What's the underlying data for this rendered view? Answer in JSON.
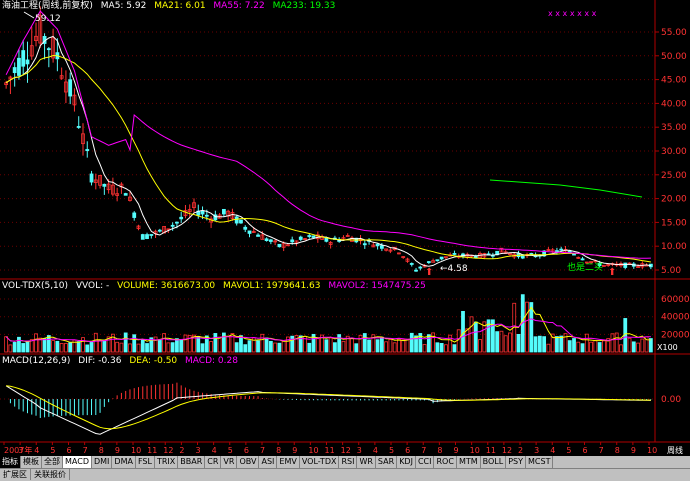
{
  "colors": {
    "up": "#ff3232",
    "down": "#54fcfc",
    "ma5": "#ffffff",
    "ma21": "#ffff00",
    "ma55": "#ff00ff",
    "ma233": "#00ff00",
    "grid": "#8b0000",
    "axis_text": "#ff3232",
    "text_white": "#ffffff"
  },
  "price_header": {
    "title": "海油工程(周线,前复权)",
    "ma5": "MA5: 5.92",
    "ma21": "MA21: 6.01",
    "ma55": "MA55: 7.22",
    "ma233": "MA233: 19.33"
  },
  "price_panel": {
    "y_ticks": [
      "55.00",
      "50.00",
      "45.00",
      "40.00",
      "35.00",
      "30.00",
      "25.00",
      "20.00",
      "15.00",
      "10.00",
      "5.00"
    ],
    "high_label": "59.12",
    "low_label": "4.58",
    "annotation": "也是二买",
    "top_markers": "x x x    x x x x"
  },
  "volume_header": {
    "name": "VOL-TDX(5,10)",
    "vvol": "VVOL: -",
    "volume": "VOLUME: 3616673.00",
    "mavol1": "MAVOL1: 1979641.63",
    "mavol2": "MAVOL2: 1547475.25"
  },
  "volume_panel": {
    "y_ticks": [
      "60000",
      "40000",
      "20000"
    ],
    "unit": "X100"
  },
  "macd_header": {
    "name": "MACD(12,26,9)",
    "dif": "DIF: -0.36",
    "dea": "DEA: -0.50",
    "macd": "MACD: 0.28"
  },
  "macd_panel": {
    "y_ticks": [
      "0.00"
    ]
  },
  "date_axis": {
    "labels": [
      "2007年",
      "3",
      "4",
      "5",
      "6",
      "7",
      "8",
      "9",
      "10",
      "11",
      "12",
      "2",
      "3",
      "4",
      "5",
      "6",
      "7",
      "8",
      "9",
      "10",
      "11",
      "12",
      "3",
      "4",
      "5",
      "6",
      "7",
      "8",
      "9",
      "10",
      "11",
      "12",
      "2",
      "3",
      "4",
      "5",
      "6",
      "7",
      "8",
      "9",
      "10"
    ],
    "period": "周线"
  },
  "tabs": [
    "指标",
    "模板",
    "全部",
    "MACD",
    "DMI",
    "DMA",
    "FSL",
    "TRIX",
    "BBAR",
    "CR",
    "VR",
    "OBV",
    "ASI",
    "EMV",
    "VOL-TDX",
    "RSI",
    "WR",
    "SAR",
    "KDJ",
    "CCI",
    "ROC",
    "MTM",
    "BOLL",
    "PSY",
    "MCST"
  ],
  "bottom_tabs": [
    "扩展区",
    "关联报价"
  ]
}
